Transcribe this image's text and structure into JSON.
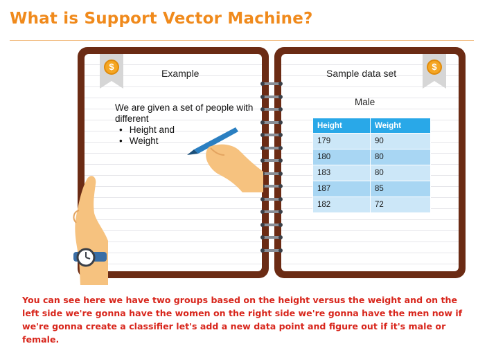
{
  "title": "What is Support Vector Machine?",
  "left_page": {
    "heading": "Example",
    "intro": "We are given a set of people with different",
    "bullets": [
      "Height and",
      "Weight"
    ]
  },
  "right_page": {
    "heading": "Sample data set",
    "subheading": "Male",
    "table": {
      "headers": [
        "Height",
        "Weight"
      ],
      "rows": [
        [
          "179",
          "90"
        ],
        [
          "180",
          "80"
        ],
        [
          "183",
          "80"
        ],
        [
          "187",
          "85"
        ],
        [
          "182",
          "72"
        ]
      ]
    }
  },
  "icons": {
    "left_bookmark": "dollar-coin-icon",
    "right_bookmark": "dollar-coin-icon",
    "coin_symbol": "$"
  },
  "colors": {
    "title": "#f08a1c",
    "caption": "#d8261c",
    "cover": "#6b2b14",
    "table_header": "#29a8e8"
  },
  "caption": "You can see here we have two groups based on the height versus the weight and on the left side we're gonna have the women on the right side we're gonna have the men now if we're gonna create a classifier let's add a new data point and figure out if it's male or female."
}
